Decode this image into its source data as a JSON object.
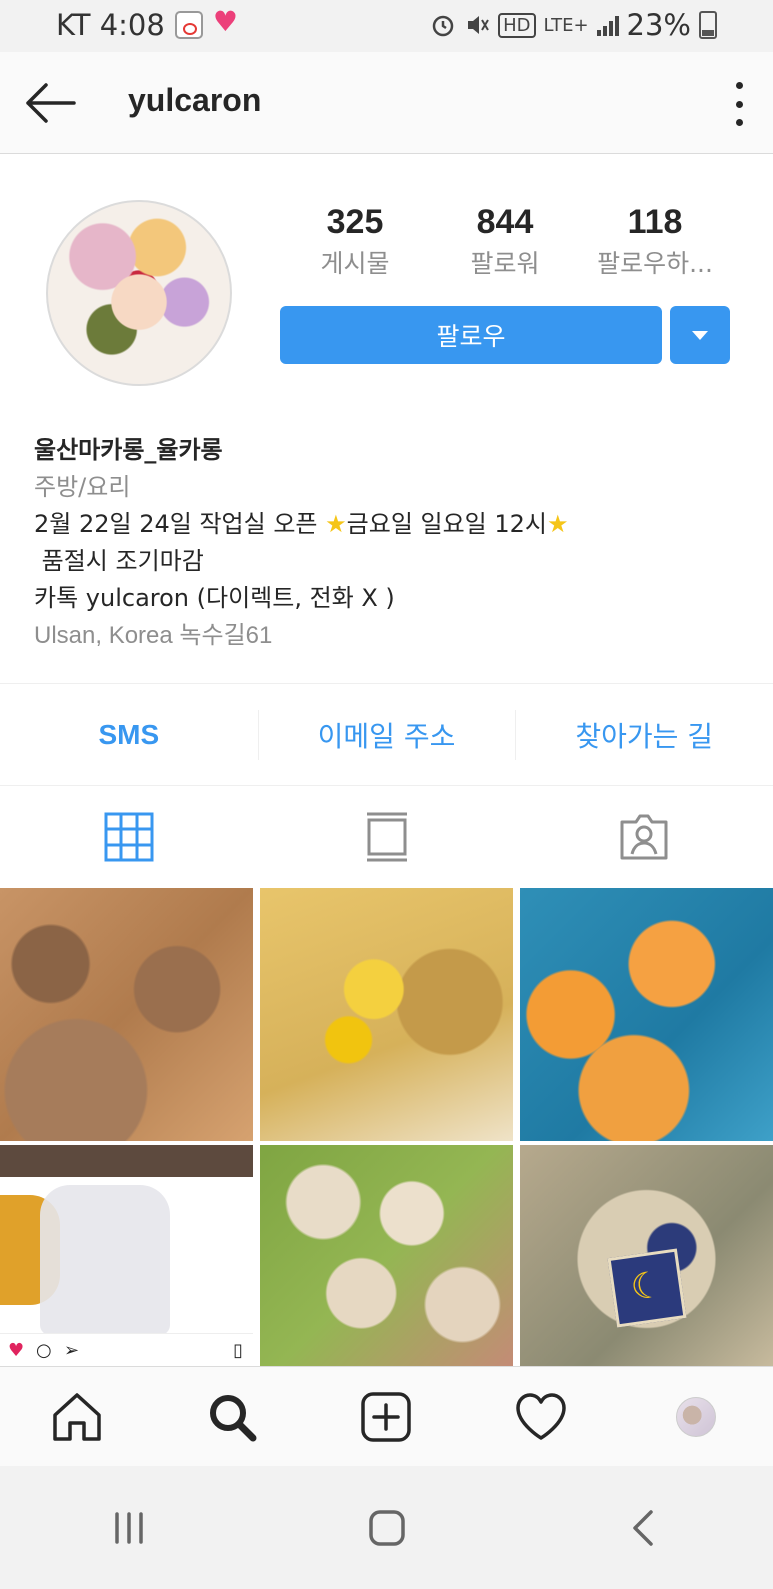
{
  "status_bar": {
    "carrier_time": "KT 4:08",
    "network": "LTE+",
    "hd_label": "HD",
    "battery": "23%"
  },
  "header": {
    "username": "yulcaron"
  },
  "profile": {
    "stats": [
      {
        "value": "325",
        "label": "게시물"
      },
      {
        "value": "844",
        "label": "팔로워"
      },
      {
        "value": "118",
        "label": "팔로우하..."
      }
    ],
    "follow_label": "팔로우",
    "bio": {
      "name": "울산마카롱_율카롱",
      "category": "주방/요리",
      "line1_a": "2월 22일 24일 작업실 오픈 ",
      "line1_b": "금요일 일요일 12시",
      "line2": " 품절시 조기마감",
      "line3": "카톡 yulcaron (다이렉트, 전화  X )",
      "location": "Ulsan, Korea 녹수길61"
    }
  },
  "contact": {
    "sms": "SMS",
    "email": "이메일 주소",
    "directions": "찾아가는 길"
  },
  "tabs": [
    "grid-icon",
    "feed-icon",
    "tagged-icon"
  ],
  "nav": [
    "home-icon",
    "search-icon",
    "add-icon",
    "heart-icon",
    "profile-avatar"
  ],
  "colors": {
    "accent": "#3897f0",
    "text": "#262626",
    "muted": "#8e8e8e"
  }
}
